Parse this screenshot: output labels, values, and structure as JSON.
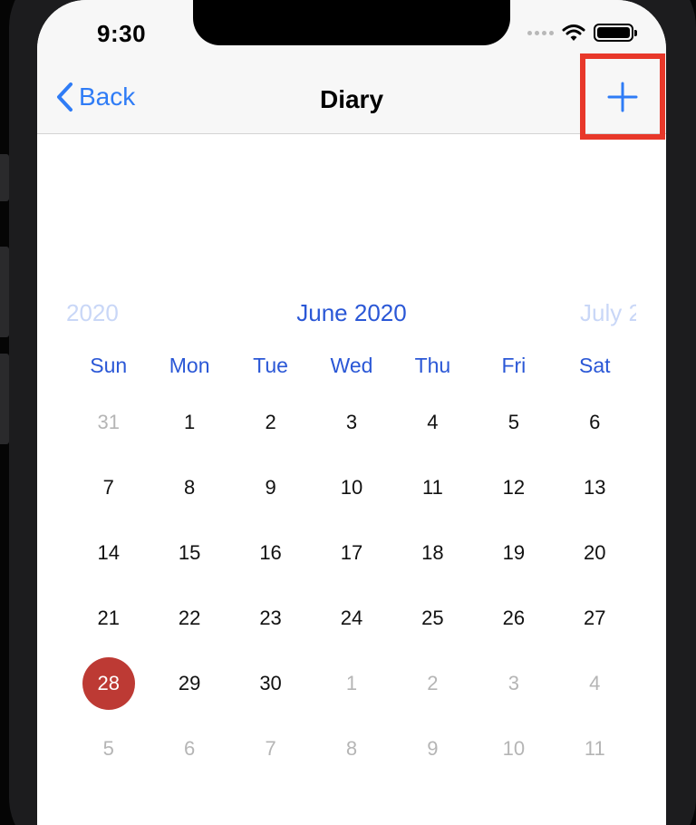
{
  "status_bar": {
    "time": "9:30"
  },
  "nav": {
    "back_label": "Back",
    "title": "Diary",
    "add_icon": "plus-icon"
  },
  "calendar": {
    "prev_month": "2020",
    "current_month": "June 2020",
    "next_month": "July 2",
    "weekdays": [
      "Sun",
      "Mon",
      "Tue",
      "Wed",
      "Thu",
      "Fri",
      "Sat"
    ],
    "days": [
      {
        "d": "31",
        "m": true
      },
      {
        "d": "1"
      },
      {
        "d": "2"
      },
      {
        "d": "3"
      },
      {
        "d": "4"
      },
      {
        "d": "5"
      },
      {
        "d": "6"
      },
      {
        "d": "7"
      },
      {
        "d": "8"
      },
      {
        "d": "9"
      },
      {
        "d": "10"
      },
      {
        "d": "11"
      },
      {
        "d": "12"
      },
      {
        "d": "13"
      },
      {
        "d": "14"
      },
      {
        "d": "15"
      },
      {
        "d": "16"
      },
      {
        "d": "17"
      },
      {
        "d": "18"
      },
      {
        "d": "19"
      },
      {
        "d": "20"
      },
      {
        "d": "21"
      },
      {
        "d": "22"
      },
      {
        "d": "23"
      },
      {
        "d": "24"
      },
      {
        "d": "25"
      },
      {
        "d": "26"
      },
      {
        "d": "27"
      },
      {
        "d": "28",
        "s": true
      },
      {
        "d": "29"
      },
      {
        "d": "30"
      },
      {
        "d": "1",
        "m": true
      },
      {
        "d": "2",
        "m": true
      },
      {
        "d": "3",
        "m": true
      },
      {
        "d": "4",
        "m": true
      },
      {
        "d": "5",
        "m": true
      },
      {
        "d": "6",
        "m": true
      },
      {
        "d": "7",
        "m": true
      },
      {
        "d": "8",
        "m": true
      },
      {
        "d": "9",
        "m": true
      },
      {
        "d": "10",
        "m": true
      },
      {
        "d": "11",
        "m": true
      }
    ]
  },
  "colors": {
    "accent": "#2f7cf6",
    "month_text": "#2a57d6",
    "selected_day": "#bd3a34",
    "highlight_box": "#e8382a"
  }
}
